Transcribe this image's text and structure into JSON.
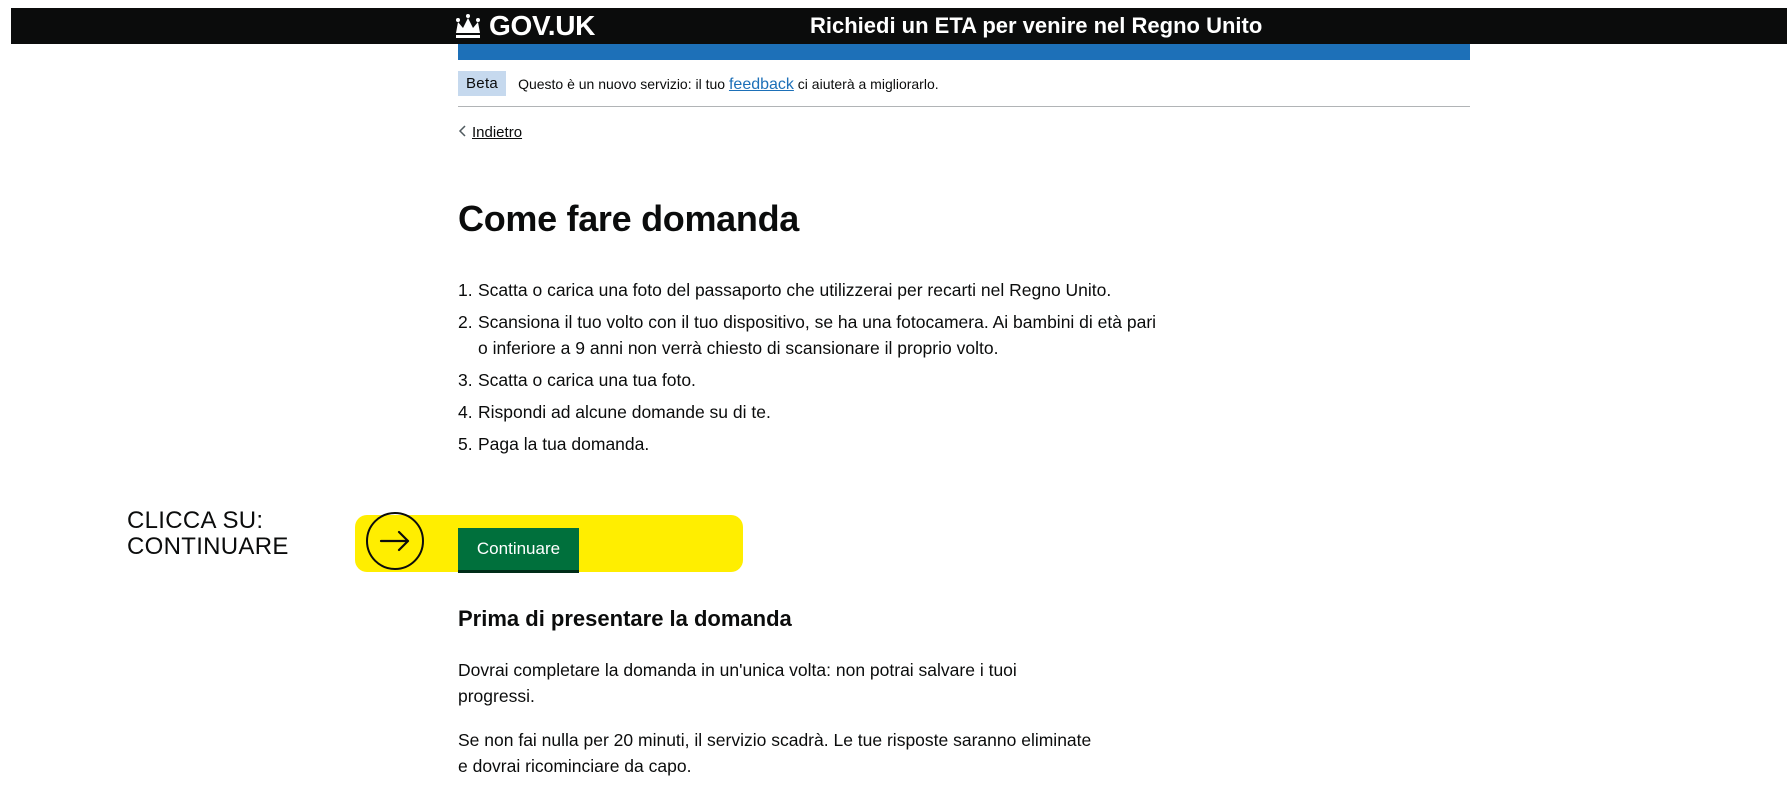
{
  "header": {
    "logo_text": "GOV.UK",
    "service_name": "Richiedi un ETA per venire nel Regno Unito"
  },
  "phase_banner": {
    "tag": "Beta",
    "text_before": "Questo è un nuovo servizio: il tuo ",
    "link": "feedback",
    "text_after": " ci aiuterà a migliorarlo."
  },
  "back_link": "Indietro",
  "page_title": "Come fare domanda",
  "steps": [
    {
      "num": "1.",
      "text": "Scatta o carica una foto del passaporto che utilizzerai per recarti nel Regno Unito."
    },
    {
      "num": "2.",
      "text": "Scansiona il tuo volto con il tuo dispositivo, se ha una fotocamera. Ai bambini di età pari o inferiore a 9 anni non verrà chiesto di scansionare il proprio volto."
    },
    {
      "num": "3.",
      "text": "Scatta o carica una tua foto."
    },
    {
      "num": "4.",
      "text": "Rispondi ad alcune domande su di te."
    },
    {
      "num": "5.",
      "text": "Paga la tua domanda."
    }
  ],
  "continue_button": "Continuare",
  "callout": {
    "line1": "CLICCA SU:",
    "line2": "CONTINUARE"
  },
  "section_heading": "Prima di presentare la domanda",
  "paragraphs": [
    "Dovrai completare la domanda in un'unica volta: non potrai salvare i tuoi progressi.",
    "Se non fai nulla per 20 minuti, il servizio scadrà. Le tue risposte saranno eliminate e dovrai ricominciare da capo."
  ],
  "icons": {
    "crown": "crown-icon",
    "back": "chevron-left-icon",
    "arrow": "arrow-right-circle-icon"
  },
  "colors": {
    "header_bg": "#0b0c0c",
    "brand_blue": "#1d70b8",
    "button_green": "#00703c",
    "highlight_yellow": "#ffee00",
    "beta_tag_bg": "#c6d9ee"
  }
}
